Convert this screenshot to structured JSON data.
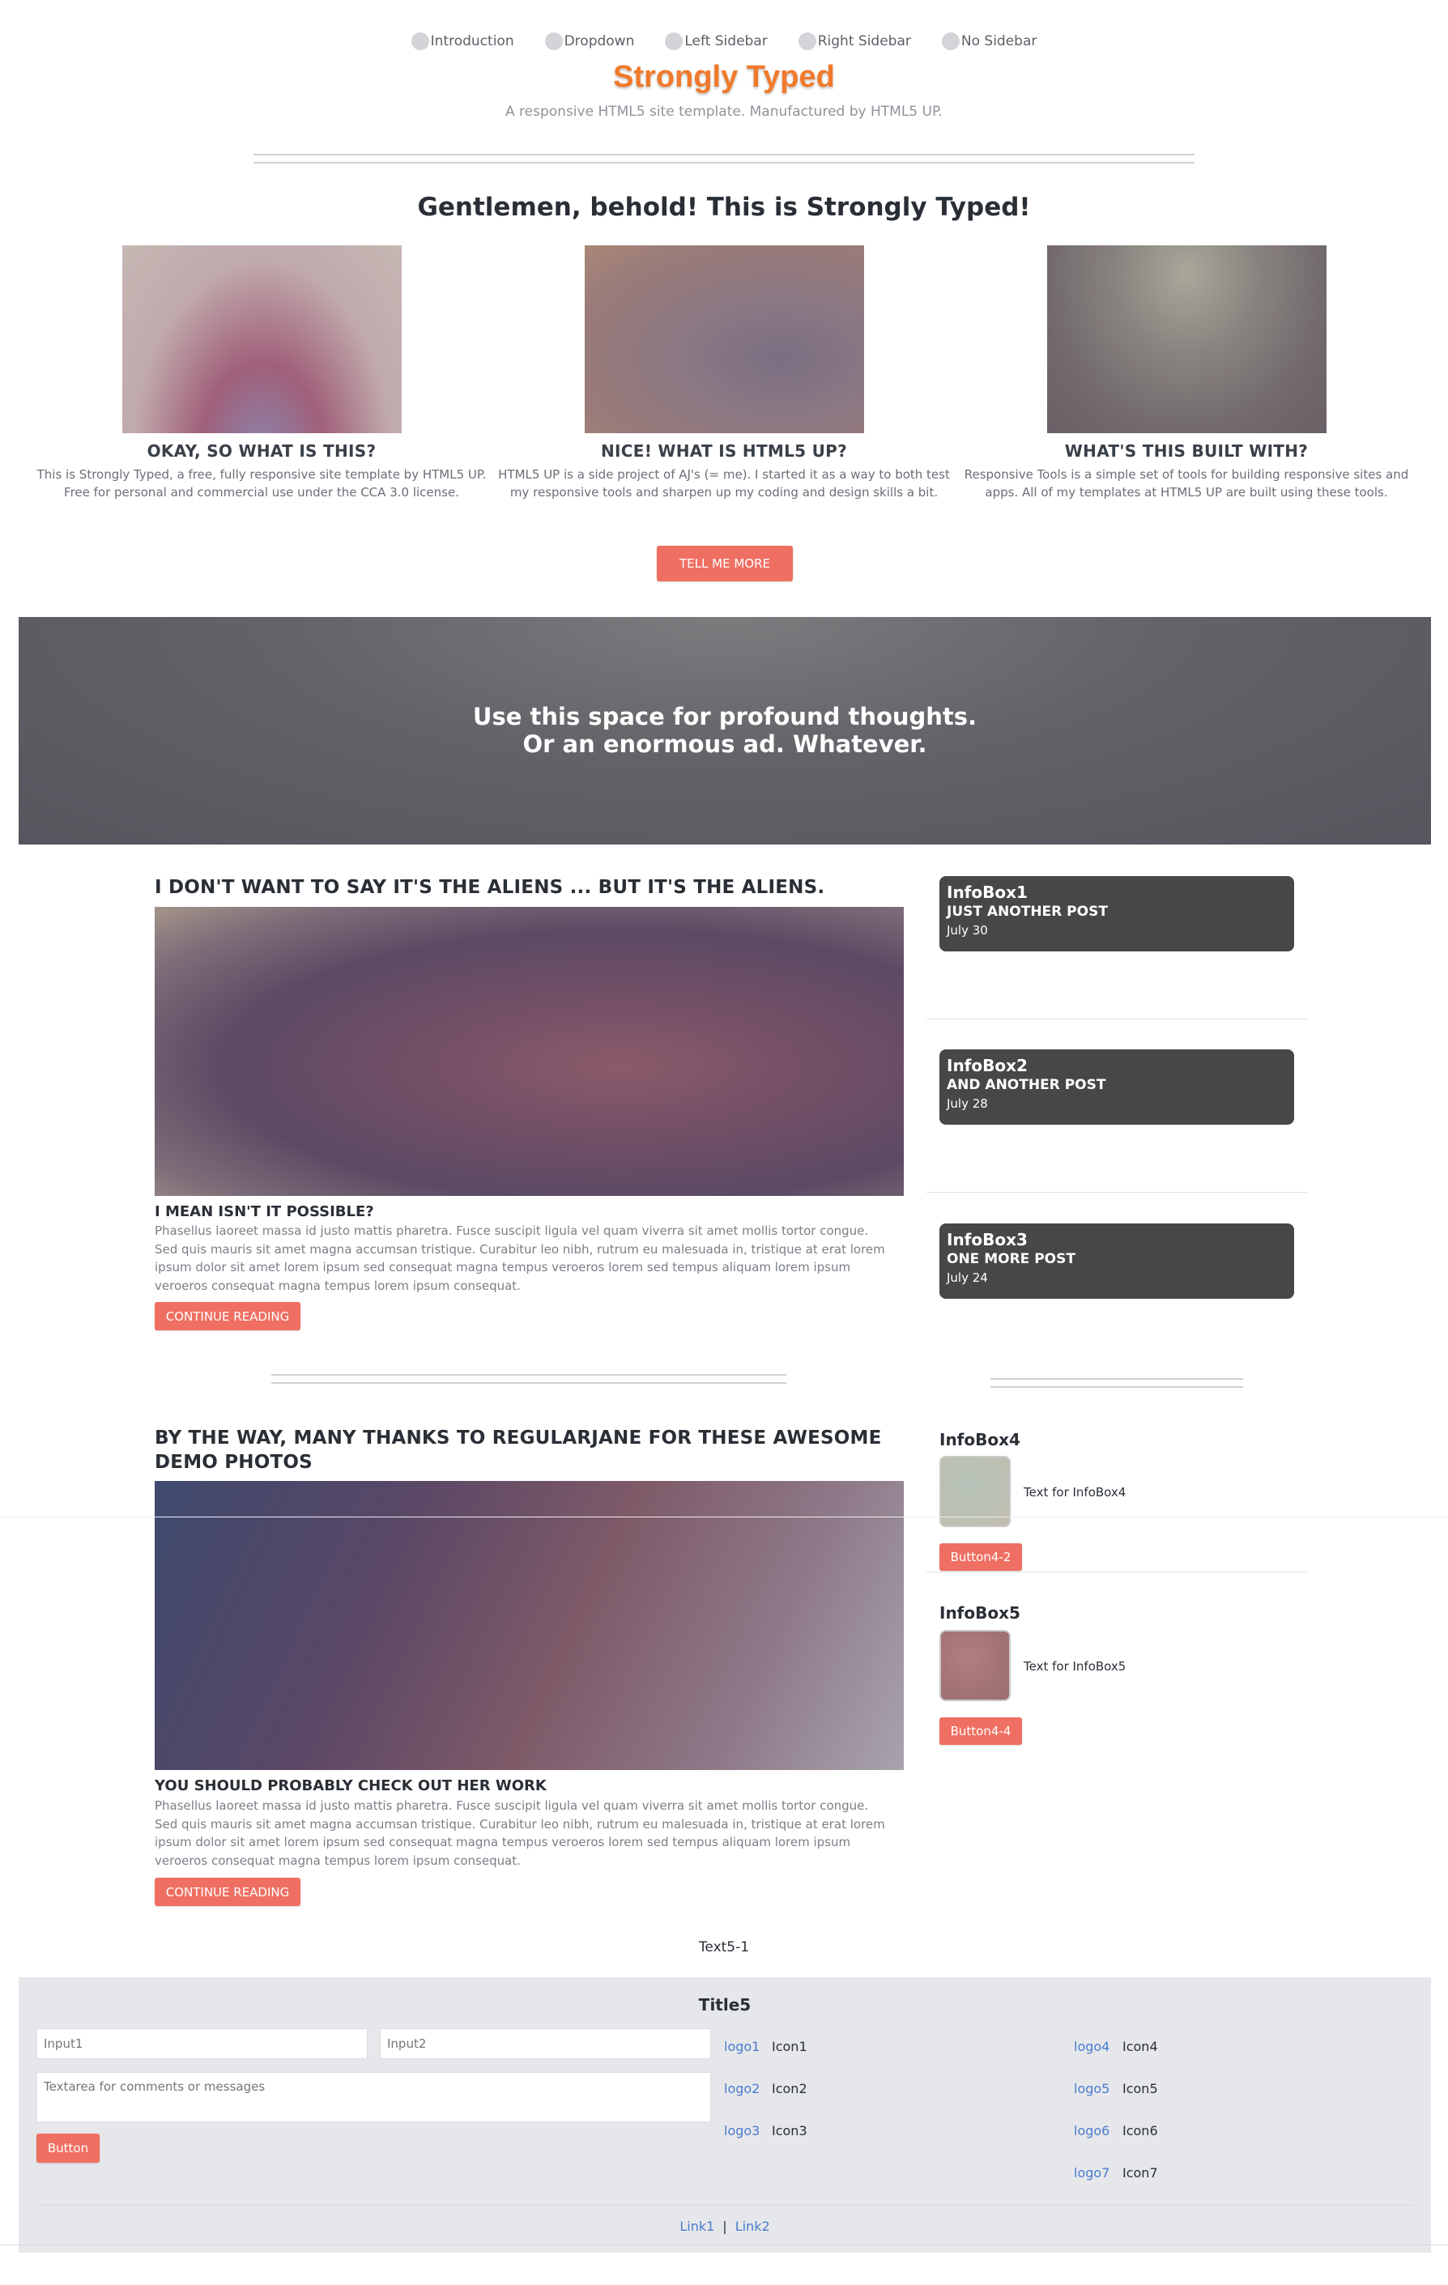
{
  "nav": [
    "Introduction",
    "Dropdown",
    "Left Sidebar",
    "Right Sidebar",
    "No Sidebar"
  ],
  "header": {
    "title": "Strongly Typed",
    "subtitle": "A responsive HTML5 site template. Manufactured by HTML5 UP."
  },
  "banner": {
    "title": "Gentlemen, behold! This is Strongly Typed!",
    "features": [
      {
        "heading": "OKAY, SO WHAT IS THIS?",
        "text": "This is Strongly Typed, a free, fully responsive site template by HTML5 UP. Free for personal and commercial use under the CCA 3.0 license."
      },
      {
        "heading": "NICE! WHAT IS HTML5 UP?",
        "text": "HTML5 UP is a side project of AJ's (= me). I started it as a way to both test my responsive tools and sharpen up my coding and design skills a bit."
      },
      {
        "heading": "WHAT'S THIS BUILT WITH?",
        "text": "Responsive Tools is a simple set of tools for building responsive sites and apps. All of my templates at HTML5 UP are built using these tools."
      }
    ],
    "button": "TELL ME MORE"
  },
  "hero": {
    "line1": "Use this space for profound thoughts.",
    "line2": "Or an enormous ad. Whatever."
  },
  "posts": [
    {
      "title": "I DON'T WANT TO SAY IT'S THE ALIENS ... BUT IT'S THE ALIENS.",
      "subtitle": "I MEAN ISN'T IT POSSIBLE?",
      "body": "Phasellus laoreet massa id justo mattis pharetra. Fusce suscipit ligula vel quam viverra sit amet mollis tortor congue. Sed quis mauris sit amet magna accumsan tristique. Curabitur leo nibh, rutrum eu malesuada in, tristique at erat lorem ipsum dolor sit amet lorem ipsum sed consequat magna tempus veroeros lorem sed tempus aliquam lorem ipsum veroeros consequat magna tempus lorem ipsum consequat.",
      "button": "CONTINUE READING"
    },
    {
      "title": "BY THE WAY, MANY THANKS TO REGULARJANE FOR THESE AWESOME DEMO PHOTOS",
      "subtitle": "YOU SHOULD PROBABLY CHECK OUT HER WORK",
      "body": "Phasellus laoreet massa id justo mattis pharetra. Fusce suscipit ligula vel quam viverra sit amet mollis tortor congue. Sed quis mauris sit amet magna accumsan tristique. Curabitur leo nibh, rutrum eu malesuada in, tristique at erat lorem ipsum dolor sit amet lorem ipsum sed consequat magna tempus veroeros lorem sed tempus aliquam lorem ipsum veroeros consequat magna tempus lorem ipsum consequat.",
      "button": "CONTINUE READING"
    }
  ],
  "infoboxes": [
    {
      "title": "InfoBox1",
      "subtitle": "JUST ANOTHER POST",
      "date": "July 30"
    },
    {
      "title": "InfoBox2",
      "subtitle": "AND ANOTHER POST",
      "date": "July 28"
    },
    {
      "title": "InfoBox3",
      "subtitle": "ONE MORE POST",
      "date": "July 24"
    }
  ],
  "infobox4": {
    "title": "InfoBox4",
    "text": "Text for InfoBox4",
    "button": "Button4-2"
  },
  "infobox5": {
    "title": "InfoBox5",
    "text": "Text for InfoBox5",
    "button": "Button4-4"
  },
  "text5": "Text5-1",
  "footer": {
    "title": "Title5",
    "input1_placeholder": "Input1",
    "input2_placeholder": "Input2",
    "textarea_placeholder": "Textarea for comments or messages",
    "button": "Button",
    "logos_left": [
      {
        "logo": "logo1",
        "icon": "Icon1"
      },
      {
        "logo": "logo2",
        "icon": "Icon2"
      },
      {
        "logo": "logo3",
        "icon": "Icon3"
      }
    ],
    "logos_right": [
      {
        "logo": "logo4",
        "icon": "Icon4"
      },
      {
        "logo": "logo5",
        "icon": "Icon5"
      },
      {
        "logo": "logo6",
        "icon": "Icon6"
      },
      {
        "logo": "logo7",
        "icon": "Icon7"
      }
    ],
    "link1": "Link1",
    "separator": "|",
    "link2": "Link2"
  },
  "colors": {
    "accent": "#ef6f62",
    "title": "#f07a2c",
    "infobox": "#474747",
    "footer_bg": "#e6e7ea",
    "link": "#4a7bd0"
  }
}
